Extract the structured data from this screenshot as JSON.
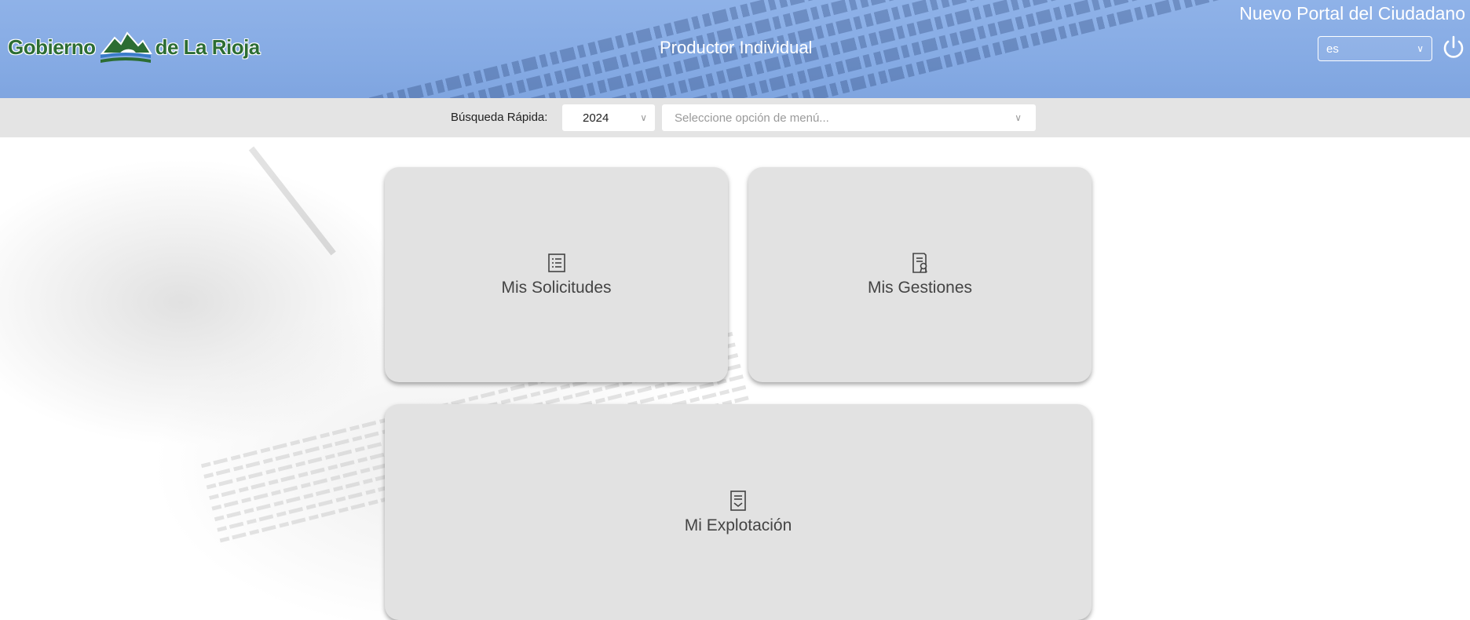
{
  "header": {
    "logo": {
      "word_left": "Gobierno",
      "word_right": "de La Rioja",
      "emblem_icon": "la-rioja-mountain-emblem"
    },
    "title": "Productor Individual",
    "portal_title": "Nuevo Portal del Ciudadano",
    "language": {
      "selected": "es",
      "icon": "chevron-down-icon"
    },
    "power_icon": "power-icon"
  },
  "search": {
    "label": "Búsqueda Rápida:",
    "year": {
      "selected": "2024",
      "icon": "chevron-down-icon"
    },
    "menu": {
      "placeholder": "Seleccione opción de menú...",
      "icon": "chevron-down-icon"
    }
  },
  "cards": [
    {
      "label": "Mis Solicitudes",
      "icon": "list-icon"
    },
    {
      "label": "Mis Gestiones",
      "icon": "document-certificate-icon"
    },
    {
      "label": "Mi Explotación",
      "icon": "document-download-icon"
    }
  ],
  "colors": {
    "header_bg": "#86abe4",
    "searchbar_bg": "#e4e4e4",
    "card_bg": "#e2e2e2",
    "logo_green": "#2c6d33",
    "text_dark": "#444444"
  }
}
